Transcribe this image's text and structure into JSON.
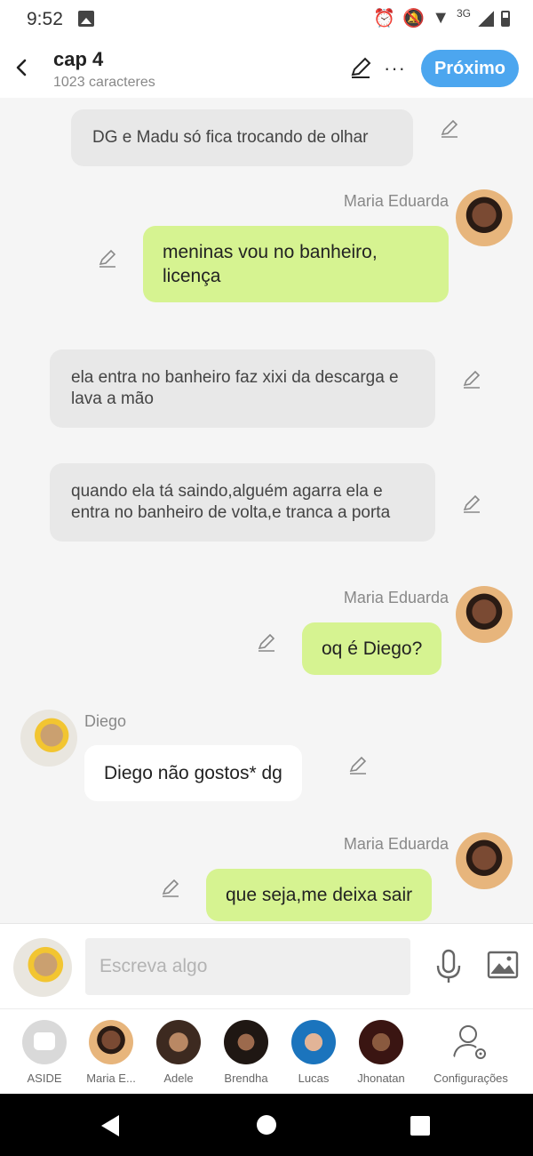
{
  "status_bar": {
    "time": "9:52",
    "network": "3G"
  },
  "header": {
    "title": "cap 4",
    "subtitle": "1023 caracteres",
    "more_label": "···",
    "next_label": "Próximo"
  },
  "messages": [
    {
      "type": "narration",
      "text": "DG e Madu só fica trocando de olhar"
    },
    {
      "type": "sent",
      "sender": "Maria Eduarda",
      "text": "meninas vou no banheiro, licença"
    },
    {
      "type": "narration",
      "text": "ela entra no banheiro faz xixi da descarga e lava a mão"
    },
    {
      "type": "narration",
      "text": "quando ela tá saindo,alguém agarra ela e entra no banheiro de volta,e tranca a porta"
    },
    {
      "type": "sent",
      "sender": "Maria Eduarda",
      "text": "oq é Diego?"
    },
    {
      "type": "received",
      "sender": "Diego",
      "text": "Diego não gostos* dg"
    },
    {
      "type": "sent",
      "sender": "Maria Eduarda",
      "text": "que seja,me deixa sair"
    }
  ],
  "composer": {
    "placeholder": "Escreva algo"
  },
  "characters": [
    {
      "label": "ASIDE"
    },
    {
      "label": "Maria E..."
    },
    {
      "label": "Adele"
    },
    {
      "label": "Brendha"
    },
    {
      "label": "Lucas"
    },
    {
      "label": "Jhonatan"
    },
    {
      "label": "Configurações"
    }
  ],
  "icons": {
    "back": "back-arrow-icon",
    "edit": "pencil-icon",
    "more": "more-dots-icon",
    "mic": "microphone-icon",
    "image": "image-icon",
    "settings": "user-gear-icon"
  },
  "colors": {
    "accent": "#4ca6ef",
    "sent_bubble": "#d6f391",
    "narration_bubble": "#e8e8e8"
  }
}
